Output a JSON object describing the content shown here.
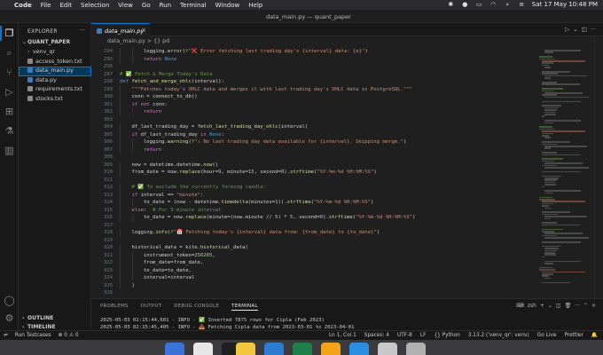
{
  "menubar": {
    "apple": "",
    "items": [
      "Code",
      "File",
      "Edit",
      "Selection",
      "View",
      "Go",
      "Run",
      "Terminal",
      "Window",
      "Help"
    ],
    "window_title": "data_main.py — quant_paper",
    "clock": "Sat 17 May  10:48 PM"
  },
  "window": {
    "title": "data_main.py — quant_paper"
  },
  "explorer": {
    "header": "EXPLORER",
    "project": "QUANT_PAPER",
    "items": [
      {
        "label": "venv_qr",
        "type": "folder"
      },
      {
        "label": "access_token.txt",
        "type": "txt"
      },
      {
        "label": "data_main.py",
        "type": "py",
        "selected": true
      },
      {
        "label": "data.py",
        "type": "py"
      },
      {
        "label": "requirements.txt",
        "type": "txt"
      },
      {
        "label": "stocks.txt",
        "type": "txt"
      }
    ],
    "outline": "OUTLINE",
    "timeline": "TIMELINE"
  },
  "editor": {
    "tab": "data_main.py",
    "breadcrumb": "data_main.py > {} pd"
  },
  "code": [
    {
      "n": "294",
      "t": "        logging.error(f\"❌ Error fetching last trading day's {interval} data: {e}\")",
      "i": 2
    },
    {
      "n": "295",
      "t": "        return None",
      "i": 2
    },
    {
      "n": "296",
      "t": "",
      "i": 0
    },
    {
      "n": "297",
      "t": "# ✅ Fetch & Merge Today's Data",
      "i": 0,
      "c": "cm"
    },
    {
      "n": "298",
      "t": "def fetch_and_merge_ohlc(interval):",
      "i": 0
    },
    {
      "n": "299",
      "t": "    \"\"\"Fetches today's OHLC data and merges it with last trading day's OHLC data in PostgreSQL.\"\"\"",
      "i": 1,
      "c": "st"
    },
    {
      "n": "300",
      "t": "    conn = connect_to_db()",
      "i": 1
    },
    {
      "n": "301",
      "t": "    if not conn:",
      "i": 1
    },
    {
      "n": "302",
      "t": "        return",
      "i": 2
    },
    {
      "n": "303",
      "t": "",
      "i": 0
    },
    {
      "n": "304",
      "t": "    df_last_trading_day = fetch_last_trading_day_ohlc(interval)",
      "i": 1
    },
    {
      "n": "305",
      "t": "    if df_last_trading_day is None:",
      "i": 1
    },
    {
      "n": "306",
      "t": "        logging.warning(f\"⚠ No last trading day data available for {interval}. Skipping merge.\")",
      "i": 2
    },
    {
      "n": "307",
      "t": "        return",
      "i": 2
    },
    {
      "n": "308",
      "t": "",
      "i": 0
    },
    {
      "n": "309",
      "t": "    now = datetime.datetime.now()",
      "i": 1
    },
    {
      "n": "310",
      "t": "    from_date = now.replace(hour=9, minute=15, second=0).strftime(\"%Y-%m-%d %H:%M:%S\")",
      "i": 1
    },
    {
      "n": "311",
      "t": "",
      "i": 0
    },
    {
      "n": "312",
      "t": "    # ✅ To exclude the currently forming candle:",
      "i": 1,
      "c": "cm"
    },
    {
      "n": "313",
      "t": "    if interval == \"minute\":",
      "i": 1
    },
    {
      "n": "314",
      "t": "        to_date = (now - datetime.timedelta(minutes=1)).strftime(\"%Y-%m-%d %H:%M:%S\")",
      "i": 2
    },
    {
      "n": "315",
      "t": "    else:  # For 5-minute interval",
      "i": 1
    },
    {
      "n": "316",
      "t": "        to_date = now.replace(minute=(now.minute // 5) * 5, second=0).strftime(\"%Y-%m-%d %H:%M:%S\")",
      "i": 2
    },
    {
      "n": "317",
      "t": "",
      "i": 0
    },
    {
      "n": "318",
      "t": "    logging.info(f\"📅 Fetching today's {interval} data from: {from_date} to {to_date}\")",
      "i": 1
    },
    {
      "n": "319",
      "t": "",
      "i": 0
    },
    {
      "n": "320",
      "t": "    historical_data = kite.historical_data(",
      "i": 1
    },
    {
      "n": "321",
      "t": "        instrument_token=256265,",
      "i": 2
    },
    {
      "n": "322",
      "t": "        from_date=from_date,",
      "i": 2
    },
    {
      "n": "323",
      "t": "        to_date=to_date,",
      "i": 2
    },
    {
      "n": "324",
      "t": "        interval=interval",
      "i": 2
    },
    {
      "n": "325",
      "t": "    )",
      "i": 1
    },
    {
      "n": "326",
      "t": "",
      "i": 0
    }
  ],
  "panel": {
    "tabs": [
      "PROBLEMS",
      "OUTPUT",
      "DEBUG CONSOLE",
      "TERMINAL"
    ],
    "active": "TERMINAL",
    "shell": "zsh",
    "lines": [
      "2025-05-03 02:15:44,601 - INFO - ✅ Inserted 7875 rows for Cipla (Feb 2023)",
      "2025-05-03 02:15:45,405 - INFO - 📥 Fetching Cipla data from 2023-03-01 to 2023-04-01"
    ]
  },
  "status": {
    "left": [
      "Run Testcases",
      "⊗ 0  ⚠ 0"
    ],
    "right": [
      "Ln 1, Col 1",
      "Spaces: 4",
      "UTF-8",
      "LF",
      "{} Python",
      "3.13.2 ('venv_qr': venv)",
      "Go Live",
      "Prettier"
    ]
  },
  "colors": {
    "accent": "#0078d4",
    "selection": "#04395e",
    "background": "#1f1f1f"
  }
}
